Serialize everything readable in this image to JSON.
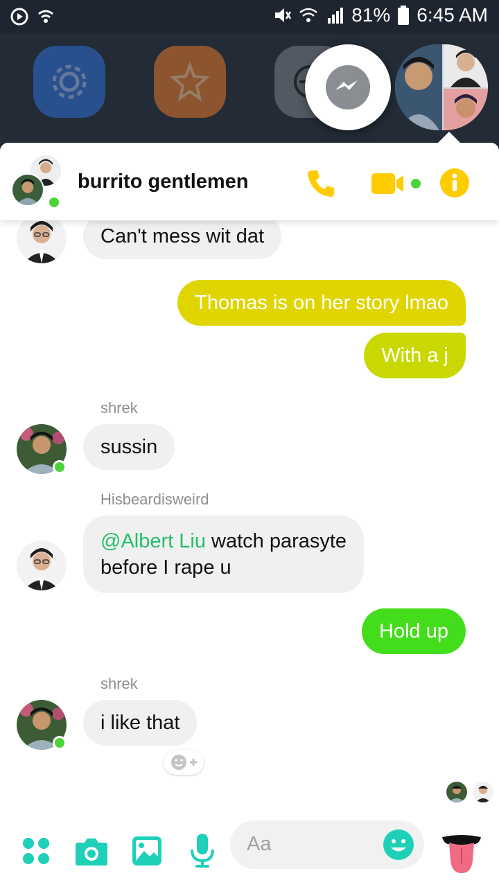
{
  "status_bar": {
    "battery": "81%",
    "time": "6:45 AM"
  },
  "conversation": {
    "title": "burrito gentlemen"
  },
  "messages": [
    {
      "text": "Can't mess wit dat"
    },
    {
      "text": "Thomas is on her story lmao"
    },
    {
      "text": "With a j"
    },
    {
      "sender": "shrek",
      "text": "sussin"
    },
    {
      "sender": "Hisbeardisweird",
      "mention": "@Albert Liu",
      "text_rest_1": " watch parasyte",
      "text_rest_2": "before I rape u"
    },
    {
      "text": "Hold up"
    },
    {
      "sender": "shrek",
      "text": "i like that"
    }
  ],
  "composer": {
    "placeholder": "Aa"
  },
  "colors": {
    "accent": "#ffcc00",
    "teal": "#1ed0b8",
    "online": "#4bd33a",
    "bubble_in": "#f0f0f0"
  },
  "icons": [
    "messenger-icon",
    "phone-icon",
    "video-icon",
    "info-icon",
    "apps-icon",
    "camera-icon",
    "gallery-icon",
    "mic-icon",
    "emoji-icon",
    "tongue-emoji-icon",
    "add-reaction-icon"
  ]
}
